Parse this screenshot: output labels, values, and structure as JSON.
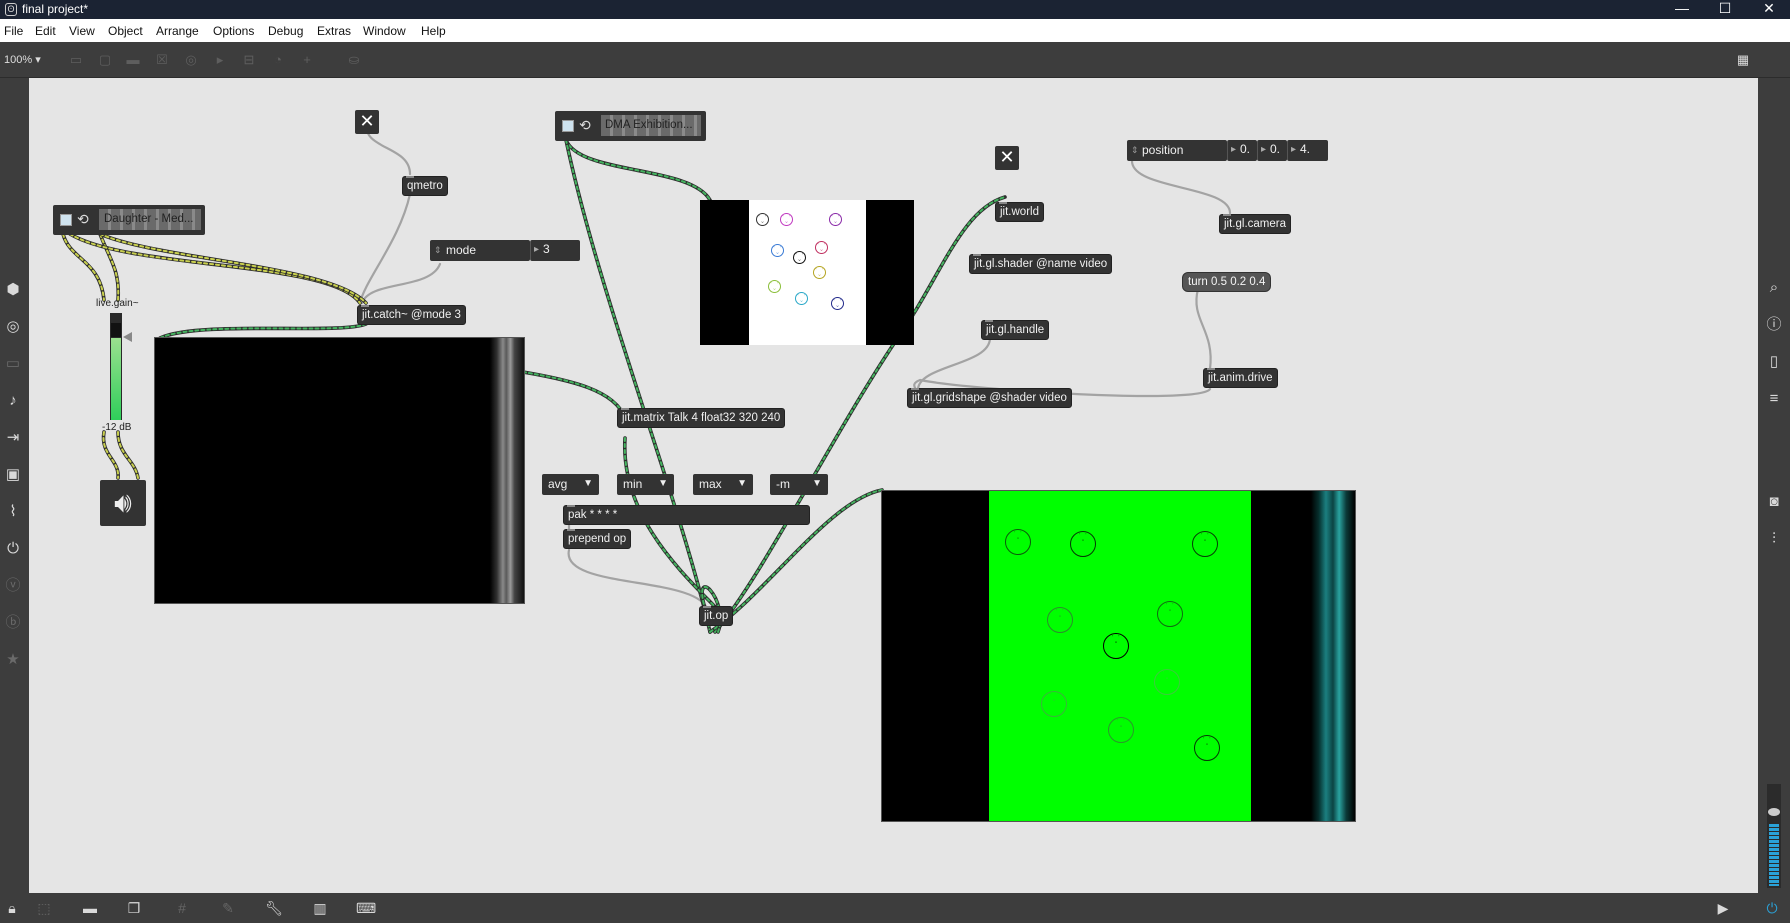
{
  "window": {
    "title": "final project*",
    "min": "—",
    "max": "☐",
    "close": "✕"
  },
  "menu": [
    "File",
    "Edit",
    "View",
    "Object",
    "Arrange",
    "Options",
    "Debug",
    "Extras",
    "Window",
    "Help"
  ],
  "toolbar": {
    "zoom": "100% ▾"
  },
  "patch": {
    "qmetro": "qmetro",
    "jit_catch": "jit.catch~ @mode 3",
    "mode_label": "mode",
    "mode_value": "3",
    "player1_name": "Daughter - Med...",
    "player2_name": "DMA Exhibition...",
    "live_gain_label": "live.gain~",
    "live_gain_db": "-12 dB",
    "jit_matrix": "jit.matrix Talk 4 float32 320 240",
    "umenu_avg": "avg",
    "umenu_min": "min",
    "umenu_max": "max",
    "umenu_m": "-m",
    "pak": "pak * * * *",
    "prepend": "prepend op",
    "jit_op": "jit.op",
    "jit_world": "jit.world",
    "jit_shader": "jit.gl.shader @name video",
    "jit_handle": "jit.gl.handle",
    "jit_gridshape": "jit.gl.gridshape @shader video",
    "position_label": "position",
    "pos_x": "0.",
    "pos_y": "0.",
    "pos_z": "4.",
    "jit_camera": "jit.gl.camera",
    "turn_msg": "turn 0.5 0.2 0.4",
    "jit_anim": "jit.anim.drive"
  },
  "colors": {
    "accent_green": "#00ff00",
    "cord_signal": "#b9c34a",
    "cord_matrix": "#3a9a54",
    "cord_plain": "#a0a0a0",
    "teal": "#1b7f80"
  }
}
